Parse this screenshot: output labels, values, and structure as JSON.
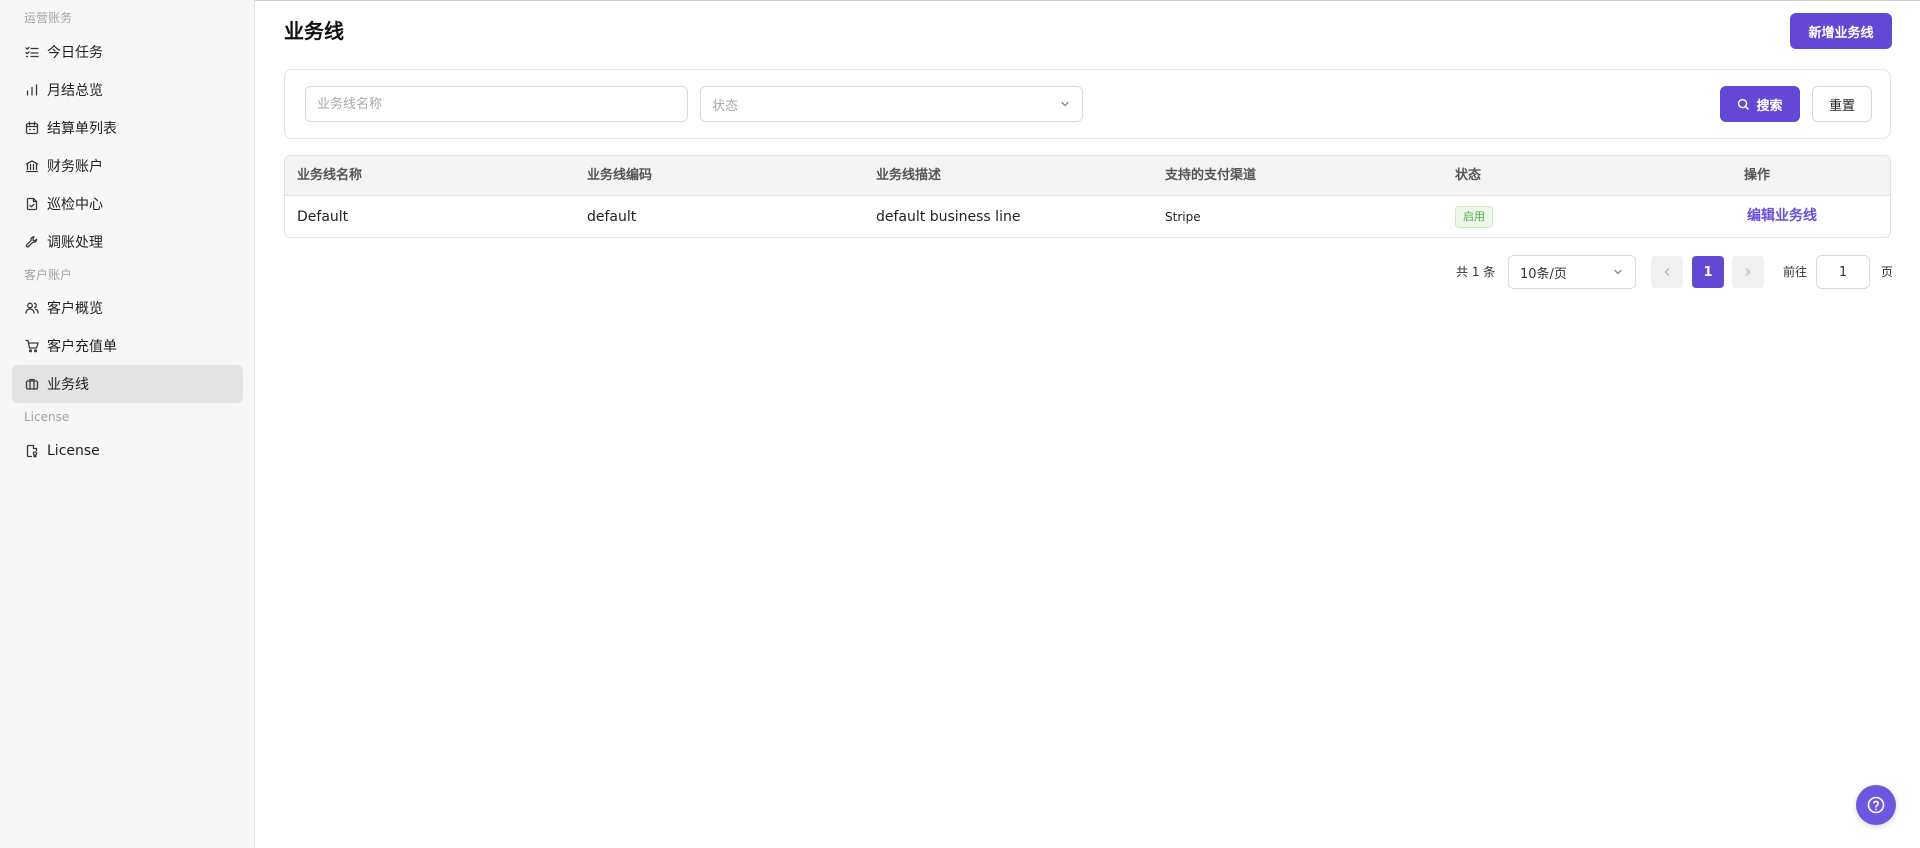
{
  "sidebar": {
    "groups": [
      {
        "label": "运营账务"
      },
      {
        "label": "客户账户"
      },
      {
        "label": "License"
      }
    ],
    "items": [
      {
        "label": "今日任务",
        "icon": "list-check-icon"
      },
      {
        "label": "月结总览",
        "icon": "bar-chart-icon"
      },
      {
        "label": "结算单列表",
        "icon": "calendar-icon"
      },
      {
        "label": "财务账户",
        "icon": "bank-icon"
      },
      {
        "label": "巡检中心",
        "icon": "file-check-icon"
      },
      {
        "label": "调账处理",
        "icon": "wrench-icon"
      },
      {
        "label": "客户概览",
        "icon": "users-icon"
      },
      {
        "label": "客户充值单",
        "icon": "cart-icon"
      },
      {
        "label": "业务线",
        "icon": "briefcase-icon",
        "active": true
      },
      {
        "label": "License",
        "icon": "license-icon"
      }
    ]
  },
  "header": {
    "title": "业务线",
    "add_button": "新增业务线"
  },
  "filters": {
    "name_placeholder": "业务线名称",
    "status_placeholder": "状态",
    "search_button": "搜索",
    "reset_button": "重置"
  },
  "table": {
    "columns": [
      "业务线名称",
      "业务线编码",
      "业务线描述",
      "支持的支付渠道",
      "状态",
      "操作"
    ],
    "rows": [
      {
        "name": "Default",
        "code": "default",
        "description": "default business line",
        "channels": "Stripe",
        "status": "启用",
        "action": "编辑业务线"
      }
    ]
  },
  "pagination": {
    "total": "共 1 条",
    "page_size": "10条/页",
    "current_page": "1",
    "goto_label": "前往",
    "goto_value": "1",
    "page_unit": "页"
  },
  "colors": {
    "accent": "#6547d6",
    "status_green": "#4caf50",
    "sidebar_bg": "#f7f7f7"
  }
}
